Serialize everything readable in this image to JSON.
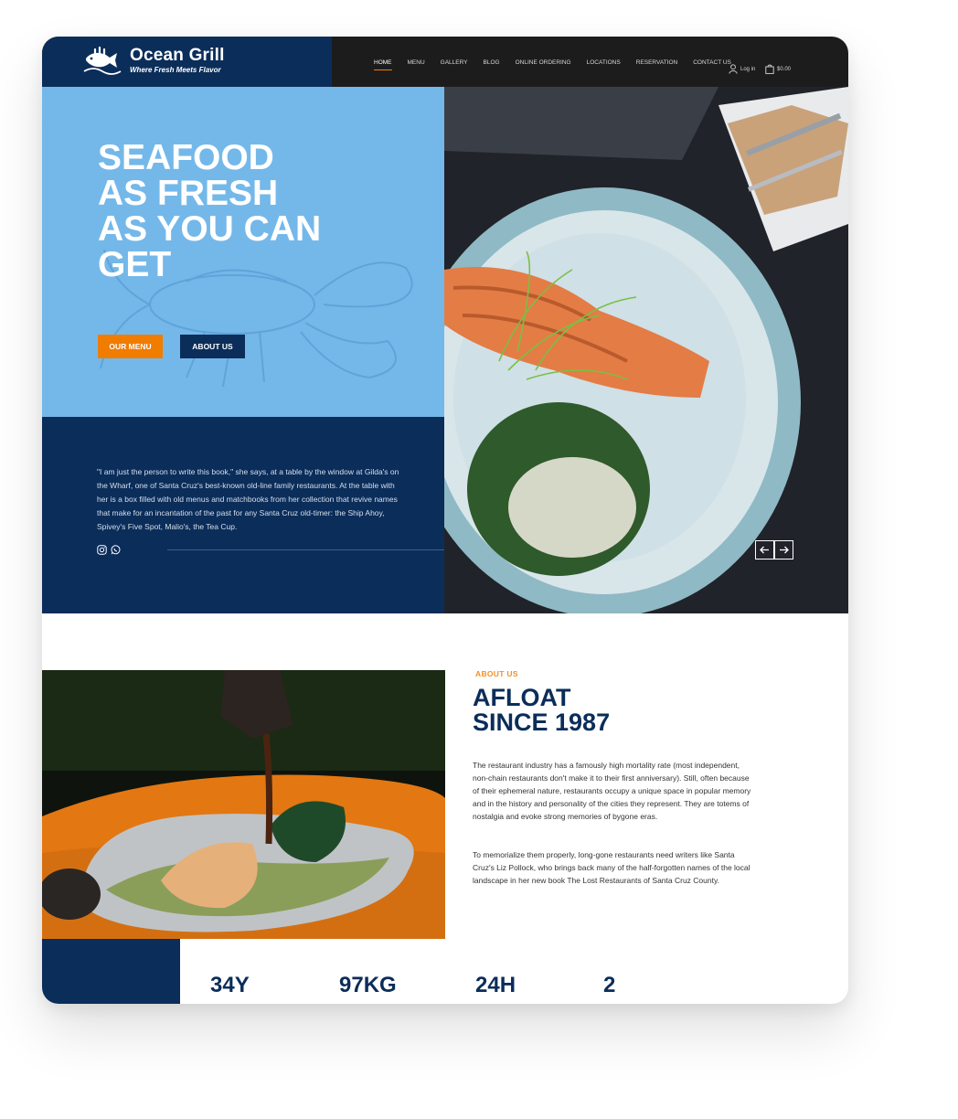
{
  "brand": {
    "name": "Ocean Grill",
    "tagline": "Where Fresh Meets Flavor"
  },
  "nav": {
    "items": [
      {
        "label": "HOME",
        "active": true
      },
      {
        "label": "MENU"
      },
      {
        "label": "GALLERY"
      },
      {
        "label": "BLOG"
      },
      {
        "label": "ONLINE ORDERING"
      },
      {
        "label": "LOCATIONS"
      },
      {
        "label": "RESERVATION"
      },
      {
        "label": "CONTACT US"
      }
    ],
    "login_label": "Log in",
    "cart_total": "$0.00"
  },
  "hero": {
    "title_lines": [
      "SEAFOOD",
      "AS FRESH",
      "AS YOU CAN",
      "GET"
    ],
    "primary_button": "OUR MENU",
    "secondary_button": "ABOUT US",
    "quote": "\"I am just the person to write this book,\" she says, at a table by the window at Gilda's on the Wharf, one of Santa Cruz's best-known old-line family restaurants. At the table with her is a box filled with old menus and matchbooks from her collection that revive names that make for an incantation of the past for any Santa Cruz old-timer: the Ship Ahoy, Spivey's Five Spot, Malio's, the Tea Cup."
  },
  "about": {
    "label": "ABOUT US",
    "title_lines": [
      "AFLOAT",
      "SINCE 1987"
    ],
    "paragraph1": "The restaurant industry has a famously high mortality rate (most independent, non-chain restaurants don't make it to their first anniversary). Still, often because of their ephemeral nature, restaurants occupy a unique space in popular memory and in the history and personality of the cities they represent. They are totems of nostalgia and evoke strong memories of bygone eras.",
    "paragraph2": "To memorialize them properly, long-gone restaurants need writers like Santa Cruz's Liz Pollock, who brings back many of the half-forgotten names of the local landscape in her new book The Lost Restaurants of Santa Cruz County."
  },
  "stats": [
    "34Y",
    "97KG",
    "24H",
    "2"
  ],
  "colors": {
    "navy": "#0b2d5a",
    "sky": "#74b8ea",
    "orange": "#f07c00",
    "header_dark": "#1c1c1c"
  },
  "icons": [
    "fish-logo-icon",
    "user-icon",
    "shopping-bag-icon",
    "instagram-icon",
    "whatsapp-icon",
    "arrow-left-icon",
    "arrow-right-icon"
  ]
}
